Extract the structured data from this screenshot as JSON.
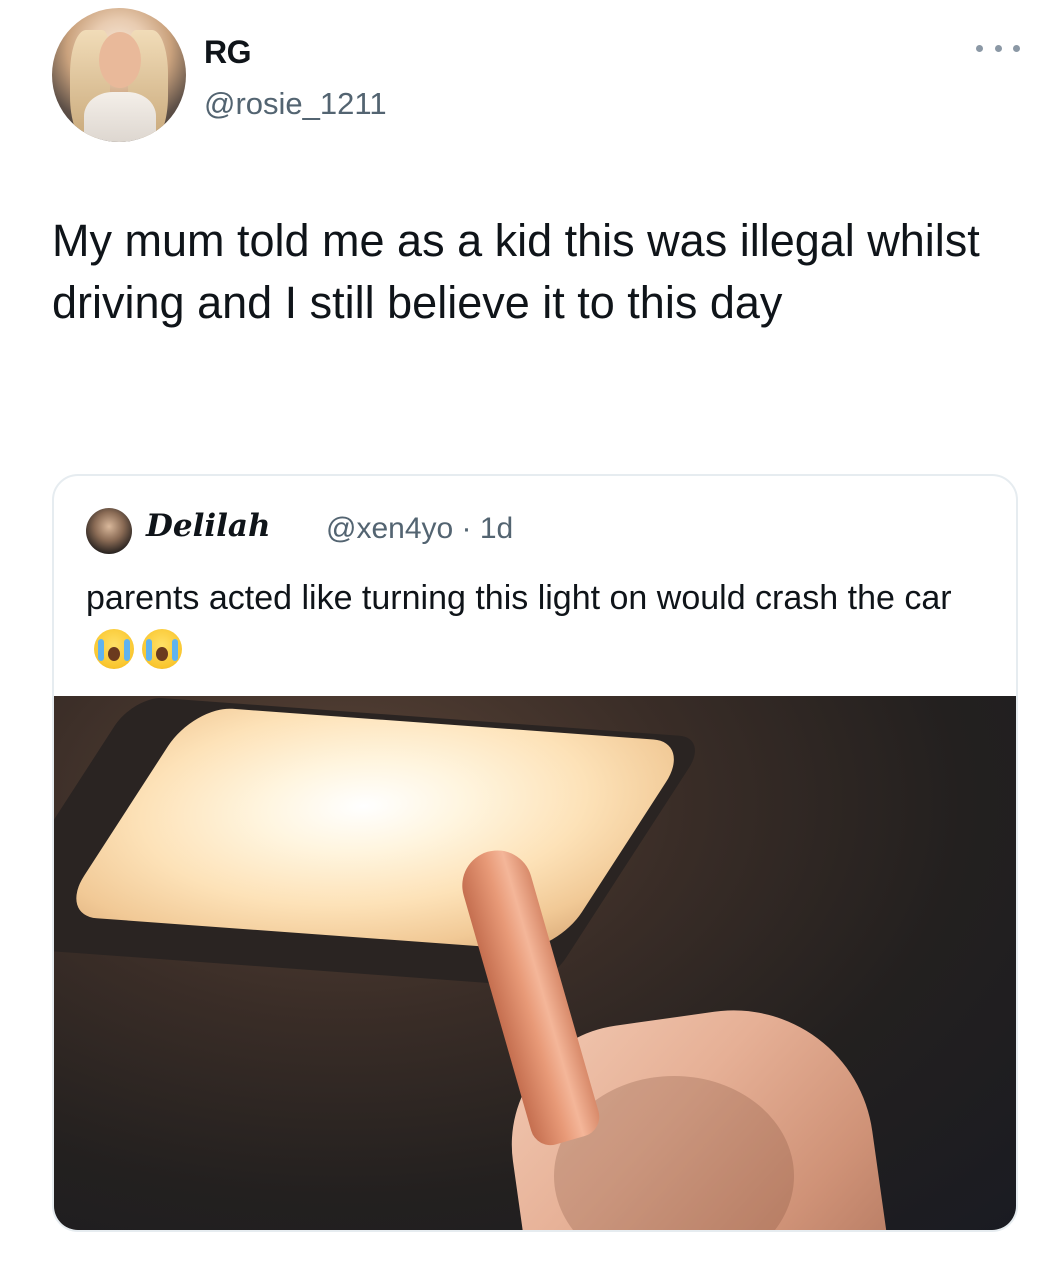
{
  "author": {
    "name": "RG",
    "handle": "@rosie_1211"
  },
  "tweet": {
    "text": "My mum told me as a kid this was illegal whilst driving and I still believe it to this day"
  },
  "quoted_tweet": {
    "name": "Delilah",
    "meta": "@xen4yo · 1d",
    "text": "parents acted like turning this light on would crash the car",
    "emojis": [
      "loudly-crying-face",
      "loudly-crying-face"
    ]
  },
  "icons": {
    "more": "more-horizontal-icon"
  },
  "colors": {
    "text_primary": "#0f1419",
    "text_secondary": "#536471",
    "border": "#e6ecf0"
  }
}
